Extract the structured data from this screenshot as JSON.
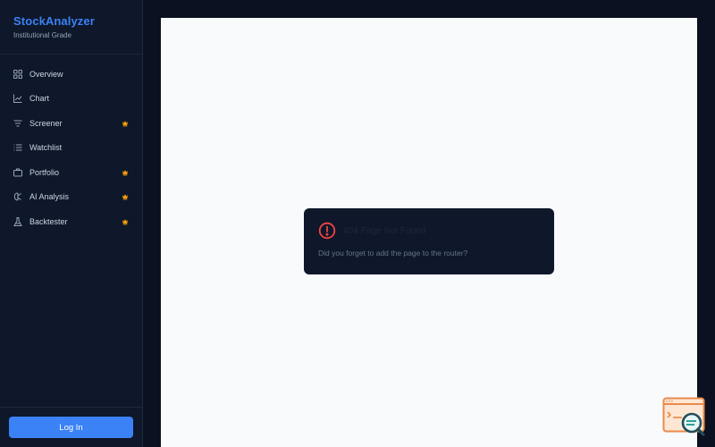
{
  "brand": {
    "title": "StockAnalyzer",
    "subtitle": "Institutional Grade"
  },
  "nav": {
    "items": [
      {
        "label": "Overview",
        "icon": "grid-icon",
        "pro": false
      },
      {
        "label": "Chart",
        "icon": "line-chart-icon",
        "pro": false
      },
      {
        "label": "Screener",
        "icon": "filter-icon",
        "pro": true
      },
      {
        "label": "Watchlist",
        "icon": "list-icon",
        "pro": false
      },
      {
        "label": "Portfolio",
        "icon": "briefcase-icon",
        "pro": true
      },
      {
        "label": "AI Analysis",
        "icon": "brain-icon",
        "pro": true
      },
      {
        "label": "Backtester",
        "icon": "flask-icon",
        "pro": true
      }
    ]
  },
  "footer": {
    "login_label": "Log In"
  },
  "error": {
    "title": "404 Page Not Found",
    "message": "Did you forget to add the page to the router?"
  },
  "colors": {
    "accent": "#3b82f6",
    "pro_badge": "#f59e0b",
    "error": "#ef4444",
    "sidebar_bg": "#0f172a",
    "page_bg": "#0b1120",
    "content_bg": "#f8fafc"
  }
}
